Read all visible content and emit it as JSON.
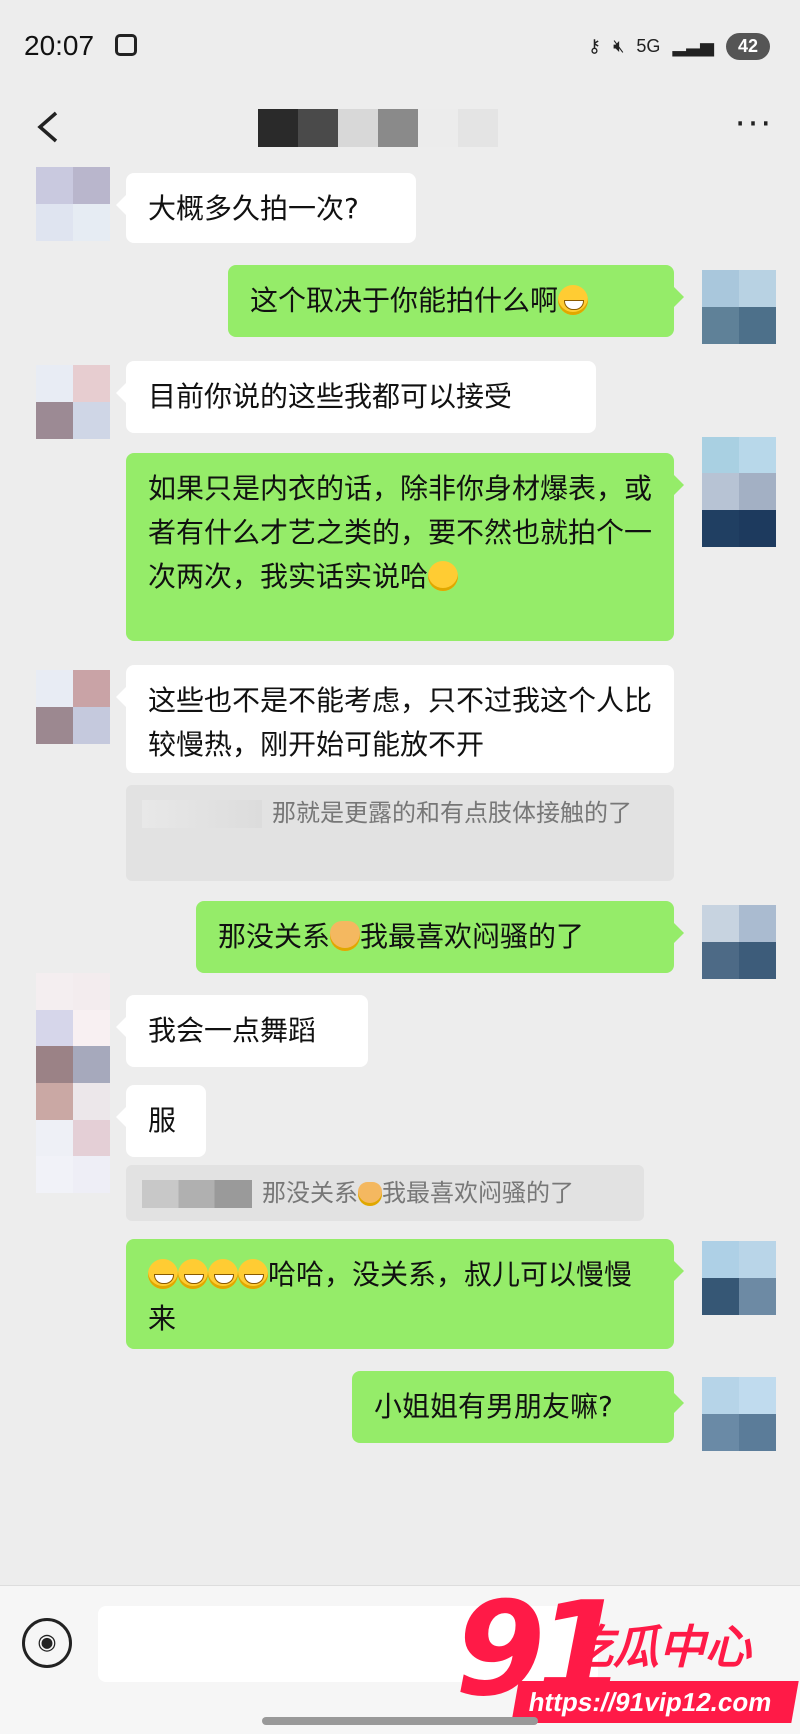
{
  "status": {
    "time": "20:07",
    "network": "5G",
    "battery": "42"
  },
  "header": {
    "more": "···"
  },
  "messages": {
    "m1": "大概多久拍一次?",
    "m2": "这个取决于你能拍什么啊",
    "m3": "目前你说的这些我都可以接受",
    "m4": "如果只是内衣的话，除非你身材爆表，或者有什么才艺之类的，要不然也就拍个一次两次，我实话实说哈",
    "m5": "这些也不是不能考虑，只不过我这个人比较慢热，刚开始可能放不开",
    "q1": "那就是更露的和有点肢体接触的了",
    "m6a": "那没关系",
    "m6b": "我最喜欢闷骚的了",
    "m7": "我会一点舞蹈",
    "m8": "服",
    "q2a": "那没关系",
    "q2b": "我最喜欢闷骚的了",
    "m9": "哈哈，没关系，叔儿可以慢慢来",
    "m10": "小姐姐有男朋友嘛?"
  },
  "watermark": {
    "number": "91",
    "text": "吃瓜中心",
    "url": "https://91vip12.com"
  },
  "colors": {
    "background": "#ededed",
    "bubble_out": "#95ec69",
    "bubble_in": "#ffffff",
    "watermark": "#ff1a47"
  }
}
